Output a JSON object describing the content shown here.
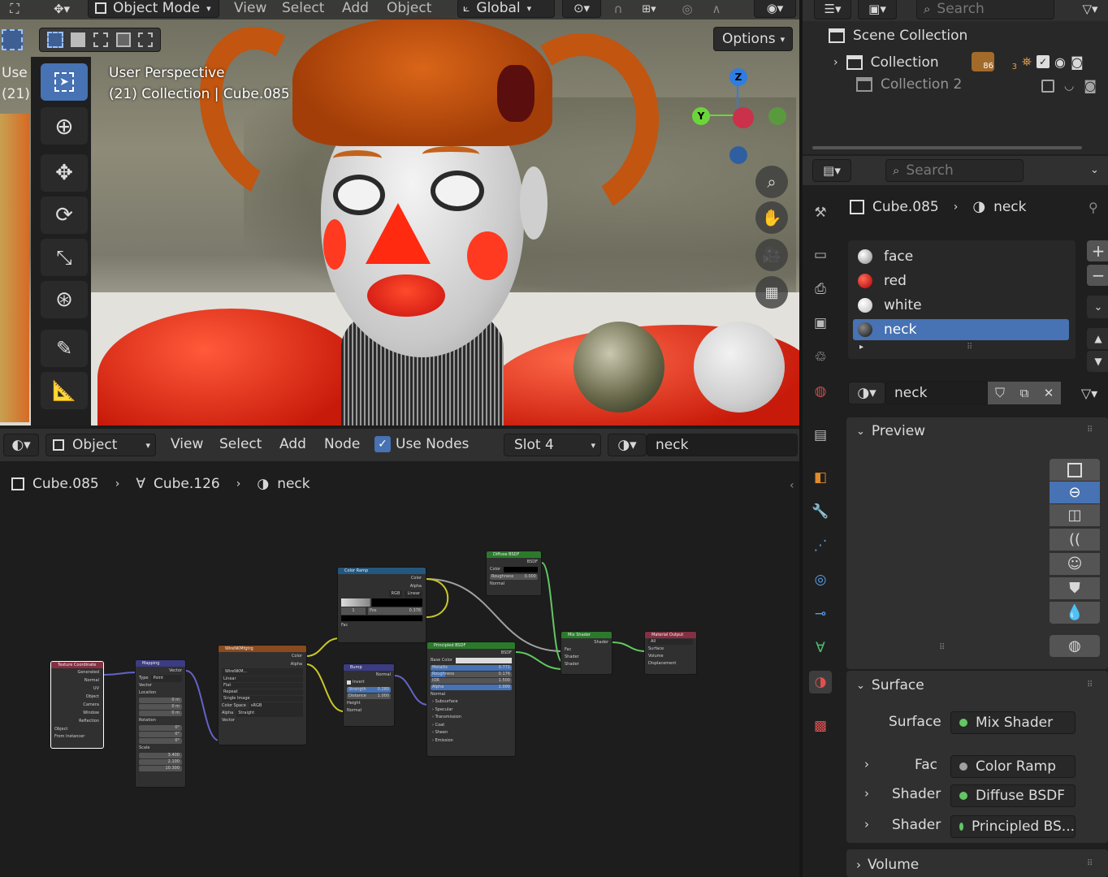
{
  "viewport": {
    "header": {
      "mode": "Object Mode",
      "menus": [
        "View",
        "Select",
        "Add",
        "Object"
      ],
      "orientation": "Global",
      "options": "Options"
    },
    "overlay_title": "User Perspective",
    "overlay_sub": "(21) Collection | Cube.085",
    "gizmo": {
      "z": "Z",
      "y": "Y"
    },
    "left_overlay_line1": "Use",
    "left_overlay_line2": "(21)"
  },
  "outliner": {
    "search_placeholder": "Search",
    "scene": "Scene Collection",
    "collection": "Collection",
    "collection2": "Collection 2",
    "badge1": "86",
    "badge2": "3"
  },
  "properties": {
    "search_placeholder": "Search",
    "breadcrumb_object": "Cube.085",
    "breadcrumb_material": "neck",
    "materials": [
      "face",
      "red",
      "white",
      "neck"
    ],
    "material_colors": [
      "#d0d0d0",
      "#d01010",
      "#e8e8e8",
      "#1a1a1a"
    ],
    "selected_material": "neck",
    "preview_label": "Preview",
    "surface_label": "Surface",
    "surface_field_label": "Surface",
    "surface_value": "Mix Shader",
    "inputs": [
      {
        "label": "Fac",
        "value": "Color Ramp",
        "dot": "#a1a1a1"
      },
      {
        "label": "Shader",
        "value": "Diffuse BSDF",
        "dot": "#63c763"
      },
      {
        "label": "Shader",
        "value": "Principled BS...",
        "dot": "#63c763"
      }
    ],
    "volume_label": "Volume"
  },
  "node_editor": {
    "header": {
      "object": "Object",
      "menus": [
        "View",
        "Select",
        "Add",
        "Node"
      ],
      "use_nodes": "Use Nodes",
      "slot": "Slot 4",
      "material": "neck"
    },
    "breadcrumb": [
      "Cube.085",
      "Cube.126",
      "neck"
    ],
    "nodes": {
      "texcoord": {
        "title": "Texture Coordinate",
        "outs": [
          "Generated",
          "Normal",
          "UV",
          "Object",
          "Camera",
          "Window",
          "Reflection"
        ],
        "object": "Object",
        "from_instancer": "From Instancer"
      },
      "mapping": {
        "title": "Mapping",
        "vector_out": "Vector",
        "type_label": "Type",
        "type_value": "Point",
        "vector_in": "Vector",
        "location": "Location",
        "rotation": "Rotation",
        "scale": "Scale",
        "loc": [
          "0 m",
          "0 m",
          "0 m"
        ],
        "rot": [
          "0°",
          "0°",
          "0°"
        ],
        "scl": [
          "3.400",
          "2.100",
          "10.300"
        ]
      },
      "image": {
        "title": "WireNKMfgtrg",
        "outs": [
          "Color",
          "Alpha"
        ],
        "name": "WireNKM...",
        "opts": [
          "Linear",
          "Flat",
          "Repeat",
          "Single Image"
        ],
        "colorspace_label": "Color Space",
        "colorspace": "sRGB",
        "alpha_label": "Alpha",
        "alpha": "Straight",
        "vector": "Vector"
      },
      "colorramp": {
        "title": "Color Ramp",
        "outs": [
          "Color",
          "Alpha"
        ],
        "mode": "RGB",
        "interp": "Linear",
        "stop": "1",
        "pos_label": "Pos",
        "pos": "0.378",
        "fac": "Fac"
      },
      "bump": {
        "title": "Bump",
        "out": "Normal",
        "invert": "Invert",
        "strength_label": "Strength",
        "strength": "0.280",
        "distance_label": "Distance",
        "distance": "1.000",
        "height": "Height",
        "normal": "Normal"
      },
      "diffuse": {
        "title": "Diffuse BSDF",
        "out": "BSDF",
        "color": "Color",
        "roughness_label": "Roughness",
        "roughness": "0.000",
        "normal": "Normal"
      },
      "principled": {
        "title": "Principled BSDF",
        "out": "BSDF",
        "base": "Base Color",
        "metallic_label": "Metallic",
        "metallic": "0.771",
        "rough_label": "Roughness",
        "rough": "0.176",
        "ior_label": "IOR",
        "ior": "1.500",
        "alpha_label": "Alpha",
        "alpha": "1.000",
        "normal": "Normal",
        "panels": [
          "Subsurface",
          "Specular",
          "Transmission",
          "Coat",
          "Sheen",
          "Emission"
        ]
      },
      "mix": {
        "title": "Mix Shader",
        "out": "Shader",
        "fac": "Fac",
        "s1": "Shader",
        "s2": "Shader"
      },
      "output": {
        "title": "Material Output",
        "target": "All",
        "surface": "Surface",
        "volume": "Volume",
        "displacement": "Displacement"
      }
    }
  },
  "colors": {
    "accent": "#4772b3",
    "header": "#303030",
    "panel": "#3d3d3d",
    "editor_bg": "#1d1d1d"
  }
}
